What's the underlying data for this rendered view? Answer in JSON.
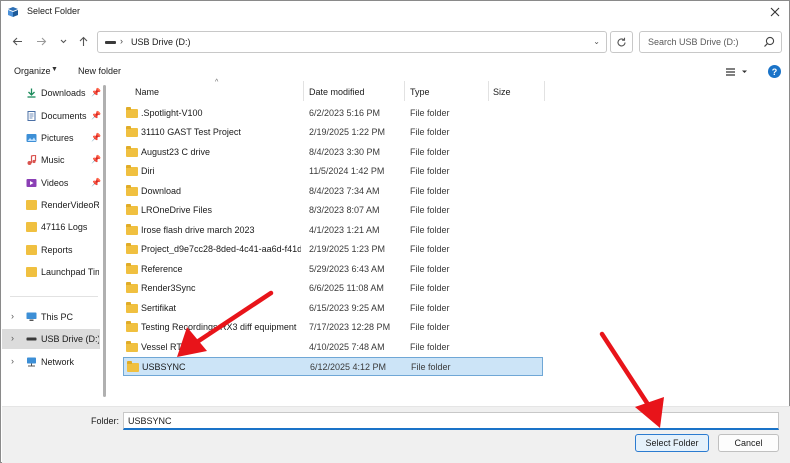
{
  "window": {
    "title": "Select Folder"
  },
  "address": {
    "path_segment": "USB Drive (D:)",
    "search_placeholder": "Search USB Drive (D:)"
  },
  "toolbar": {
    "organize_label": "Organize",
    "new_folder_label": "New folder",
    "help_label": "?"
  },
  "sidebar": {
    "items": [
      {
        "label": "Downloads",
        "icon": "download-icon",
        "pinned": true
      },
      {
        "label": "Documents",
        "icon": "documents-icon",
        "pinned": true
      },
      {
        "label": "Pictures",
        "icon": "pictures-icon",
        "pinned": true
      },
      {
        "label": "Music",
        "icon": "music-icon",
        "pinned": true
      },
      {
        "label": "Videos",
        "icon": "videos-icon",
        "pinned": true
      },
      {
        "label": "RenderVideoRec",
        "icon": "folder-icon",
        "pinned": false
      },
      {
        "label": "47116 Logs",
        "icon": "folder-icon",
        "pinned": false
      },
      {
        "label": "Reports",
        "icon": "folder-icon",
        "pinned": false
      },
      {
        "label": "Launchpad Tim",
        "icon": "folder-icon",
        "pinned": false
      },
      {
        "label": "This PC",
        "icon": "pc-icon",
        "expandable": true
      },
      {
        "label": "USB Drive (D:)",
        "icon": "usb-drive-icon",
        "expandable": true,
        "selected": true
      },
      {
        "label": "Network",
        "icon": "network-icon",
        "expandable": true
      }
    ]
  },
  "columns": {
    "name": "Name",
    "date": "Date modified",
    "type": "Type",
    "size": "Size"
  },
  "files": [
    {
      "name": ".Spotlight-V100",
      "date": "6/2/2023 5:16 PM",
      "type": "File folder"
    },
    {
      "name": "31110 GAST Test Project",
      "date": "2/19/2025 1:22 PM",
      "type": "File folder"
    },
    {
      "name": "August23 C drive",
      "date": "8/4/2023 3:30 PM",
      "type": "File folder"
    },
    {
      "name": "Diri",
      "date": "11/5/2024 1:42 PM",
      "type": "File folder"
    },
    {
      "name": "Download",
      "date": "8/4/2023 7:34 AM",
      "type": "File folder"
    },
    {
      "name": "LROneDrive Files",
      "date": "8/3/2023 8:07 AM",
      "type": "File folder"
    },
    {
      "name": "Irose flash drive march 2023",
      "date": "4/1/2023 1:21 AM",
      "type": "File folder"
    },
    {
      "name": "Project_d9e7cc28-8ded-4c41-aa6d-f41d4...",
      "date": "2/19/2025 1:23 PM",
      "type": "File folder"
    },
    {
      "name": "Reference",
      "date": "5/29/2023 6:43 AM",
      "type": "File folder"
    },
    {
      "name": "Render3Sync",
      "date": "6/6/2025 11:08 AM",
      "type": "File folder"
    },
    {
      "name": "Sertifikat",
      "date": "6/15/2023 9:25 AM",
      "type": "File folder"
    },
    {
      "name": "Testing Recordings RX3 diff equipment",
      "date": "7/17/2023 12:28 PM",
      "type": "File folder"
    },
    {
      "name": "Vessel RT",
      "date": "4/10/2025 7:48 AM",
      "type": "File folder"
    },
    {
      "name": "USBSYNC",
      "date": "6/12/2025 4:12 PM",
      "type": "File folder",
      "selected": true
    }
  ],
  "footer": {
    "folder_label": "Folder:",
    "folder_value": "USBSYNC",
    "select_label": "Select Folder",
    "cancel_label": "Cancel"
  },
  "colors": {
    "accent": "#1a73c8",
    "selection": "#cce4f7",
    "annotation_arrow": "#e8141a"
  }
}
